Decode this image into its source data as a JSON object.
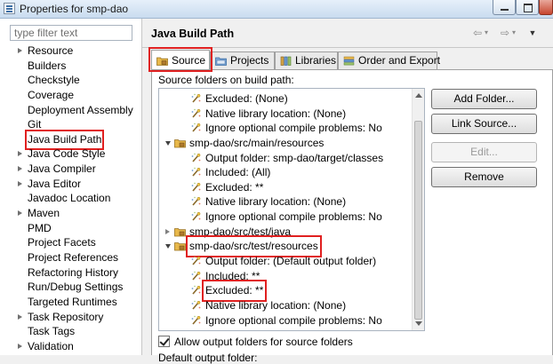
{
  "window": {
    "title": "Properties for smp-dao"
  },
  "filter": {
    "placeholder": "type filter text"
  },
  "nav": {
    "items": [
      {
        "label": "Resource",
        "expandable": true
      },
      {
        "label": "Builders",
        "expandable": false
      },
      {
        "label": "Checkstyle",
        "expandable": false
      },
      {
        "label": "Coverage",
        "expandable": false
      },
      {
        "label": "Deployment Assembly",
        "expandable": false
      },
      {
        "label": "Git",
        "expandable": false
      },
      {
        "label": "Java Build Path",
        "expandable": false,
        "selected": true
      },
      {
        "label": "Java Code Style",
        "expandable": true
      },
      {
        "label": "Java Compiler",
        "expandable": true
      },
      {
        "label": "Java Editor",
        "expandable": true
      },
      {
        "label": "Javadoc Location",
        "expandable": false
      },
      {
        "label": "Maven",
        "expandable": true
      },
      {
        "label": "PMD",
        "expandable": false
      },
      {
        "label": "Project Facets",
        "expandable": false
      },
      {
        "label": "Project References",
        "expandable": false
      },
      {
        "label": "Refactoring History",
        "expandable": false
      },
      {
        "label": "Run/Debug Settings",
        "expandable": false
      },
      {
        "label": "Targeted Runtimes",
        "expandable": false
      },
      {
        "label": "Task Repository",
        "expandable": true
      },
      {
        "label": "Task Tags",
        "expandable": false
      },
      {
        "label": "Validation",
        "expandable": true
      }
    ]
  },
  "page": {
    "title": "Java Build Path"
  },
  "tabs": [
    {
      "label": "Source",
      "icon": "source-folder-icon",
      "active": true
    },
    {
      "label": "Projects",
      "icon": "projects-icon",
      "active": false
    },
    {
      "label": "Libraries",
      "icon": "libraries-icon",
      "active": false
    },
    {
      "label": "Order and Export",
      "icon": "order-export-icon",
      "active": false
    }
  ],
  "source_tab": {
    "heading": "Source folders on build path:",
    "tree": [
      {
        "depth": 1,
        "expander": "none",
        "icon": "attribute-icon",
        "label": "Excluded: (None)"
      },
      {
        "depth": 1,
        "expander": "none",
        "icon": "attribute-icon",
        "label": "Native library location: (None)"
      },
      {
        "depth": 1,
        "expander": "none",
        "icon": "attribute-icon",
        "label": "Ignore optional compile problems: No"
      },
      {
        "depth": 0,
        "expander": "open",
        "icon": "source-folder-icon",
        "label": "smp-dao/src/main/resources"
      },
      {
        "depth": 1,
        "expander": "none",
        "icon": "attribute-icon",
        "label": "Output folder: smp-dao/target/classes"
      },
      {
        "depth": 1,
        "expander": "none",
        "icon": "attribute-icon",
        "label": "Included: (All)"
      },
      {
        "depth": 1,
        "expander": "none",
        "icon": "attribute-icon",
        "label": "Excluded: **"
      },
      {
        "depth": 1,
        "expander": "none",
        "icon": "attribute-icon",
        "label": "Native library location: (None)"
      },
      {
        "depth": 1,
        "expander": "none",
        "icon": "attribute-icon",
        "label": "Ignore optional compile problems: No"
      },
      {
        "depth": 0,
        "expander": "closed",
        "icon": "source-folder-icon",
        "label": "smp-dao/src/test/java"
      },
      {
        "depth": 0,
        "expander": "open",
        "icon": "source-folder-icon",
        "label": "smp-dao/src/test/resources",
        "highlight": true
      },
      {
        "depth": 1,
        "expander": "none",
        "icon": "attribute-icon",
        "label": "Output folder: (Default output folder)"
      },
      {
        "depth": 1,
        "expander": "none",
        "icon": "attribute-icon",
        "label": "Included: **"
      },
      {
        "depth": 1,
        "expander": "none",
        "icon": "attribute-icon",
        "label": "Excluded: **",
        "highlight": true
      },
      {
        "depth": 1,
        "expander": "none",
        "icon": "attribute-icon",
        "label": "Native library location: (None)"
      },
      {
        "depth": 1,
        "expander": "none",
        "icon": "attribute-icon",
        "label": "Ignore optional compile problems: No"
      }
    ],
    "buttons": {
      "add_folder": "Add Folder...",
      "link_source": "Link Source...",
      "edit": "Edit...",
      "remove": "Remove"
    },
    "allow_output": {
      "label": "Allow output folders for source folders",
      "checked": true
    },
    "default_output": "Default output folder:"
  },
  "colors": {
    "annotation_red": "#e02020",
    "folder_yellow": "#e8b84a",
    "package_brown": "#b07a2c"
  }
}
